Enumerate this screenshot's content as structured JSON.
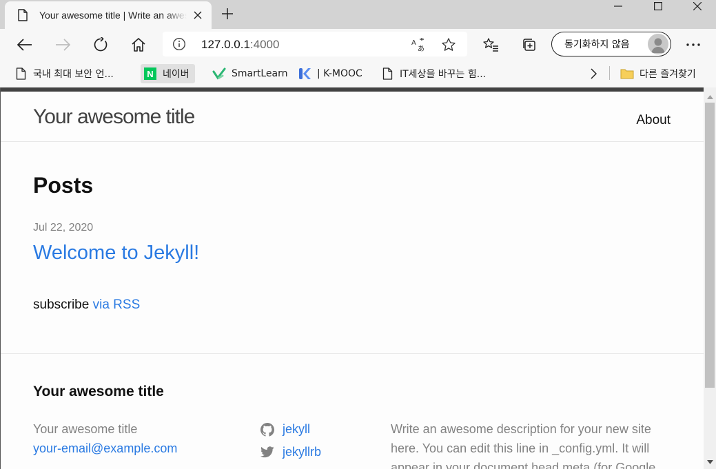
{
  "browser": {
    "tab": {
      "title": "Your awesome title | Write an awesome description for your new site",
      "icon": "page-icon",
      "close_icon": "close-icon"
    },
    "new_tab_icon": "plus-icon",
    "window_controls": [
      "minimize-icon",
      "maximize-icon",
      "close-icon"
    ],
    "toolbar": {
      "back_icon": "back-arrow-icon",
      "forward_icon": "forward-arrow-icon",
      "refresh_icon": "refresh-icon",
      "home_icon": "home-icon",
      "url_host": "127.0.0.1",
      "url_port": ":4000",
      "sync_label": "동기화하지 않음",
      "more_icon": "more-icon"
    },
    "bookmarks": [
      {
        "label": "국내 최대 보안 언...",
        "icon": "page-icon"
      },
      {
        "label": "네이버",
        "icon": "naver-icon",
        "icon_text": "N"
      },
      {
        "label": "SmartLearn",
        "icon": "smartlearn-icon"
      },
      {
        "label": "| K-MOOC",
        "icon": "kmooc-icon"
      },
      {
        "label": "IT세상을 바꾸는 힘...",
        "icon": "page-icon"
      }
    ],
    "other_favorites": "다른 즐겨찾기"
  },
  "site": {
    "title": "Your awesome title",
    "nav": {
      "about": "About"
    },
    "posts_heading": "Posts",
    "posts": [
      {
        "date": "Jul 22, 2020",
        "title": "Welcome to Jekyll!"
      }
    ],
    "subscribe": {
      "prefix": "subscribe ",
      "link": "via RSS"
    },
    "footer": {
      "heading": "Your awesome title",
      "name": "Your awesome title",
      "email": "your-email@example.com",
      "social": [
        {
          "icon": "github-icon",
          "label": "jekyll"
        },
        {
          "icon": "twitter-icon",
          "label": "jekyllrb"
        }
      ],
      "description": "Write an awesome description for your new site here. You can edit this line in _config.yml. It will appear in your document head meta (for Google"
    }
  },
  "colors": {
    "link": "#2a7ae2",
    "muted": "#828282",
    "topbar": "#424242"
  }
}
